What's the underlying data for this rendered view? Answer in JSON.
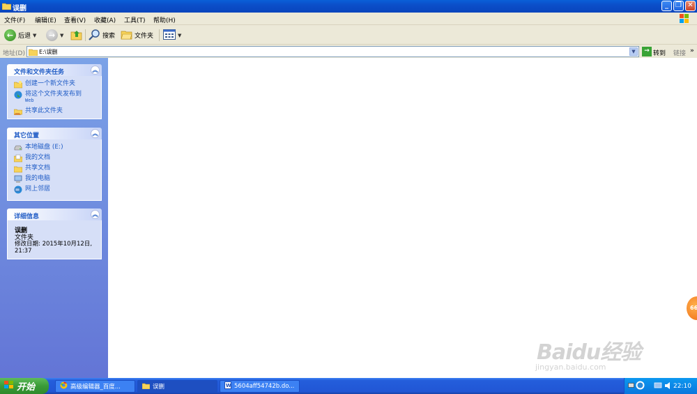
{
  "window": {
    "title": "误删",
    "caption_buttons": {
      "minimize": "_",
      "restore": "❐",
      "close": "✕"
    }
  },
  "menu": [
    "文件(F)",
    "编辑(E)",
    "查看(V)",
    "收藏(A)",
    "工具(T)",
    "帮助(H)"
  ],
  "toolbar": {
    "back_label": "后退",
    "search_label": "搜索",
    "folders_label": "文件夹"
  },
  "address": {
    "label": "地址(D)",
    "value": "E:\\误删",
    "go_label": "转到",
    "links_label": "链接"
  },
  "panels": {
    "file_tasks": {
      "title": "文件和文件夹任务",
      "items": [
        "创建一个新文件夹",
        "将这个文件夹发布到",
        "共享此文件夹"
      ],
      "publish_sub": "Web"
    },
    "other_places": {
      "title": "其它位置",
      "items": [
        "本地磁盘 (E:)",
        "我的文档",
        "共享文档",
        "我的电脑",
        "网上邻居"
      ]
    },
    "details": {
      "title": "详细信息",
      "name": "误删",
      "type": "文件夹",
      "modified": "修改日期: 2015年10月12日, 21:37"
    }
  },
  "taskbar": {
    "start_label": "开始",
    "items": [
      "高级编辑器_百度...",
      "误删",
      "5604aff54742b.do..."
    ],
    "clock": "22:10"
  },
  "watermark": {
    "logo": "Baidu经验",
    "url": "jingyan.baidu.com"
  },
  "badge": "66"
}
